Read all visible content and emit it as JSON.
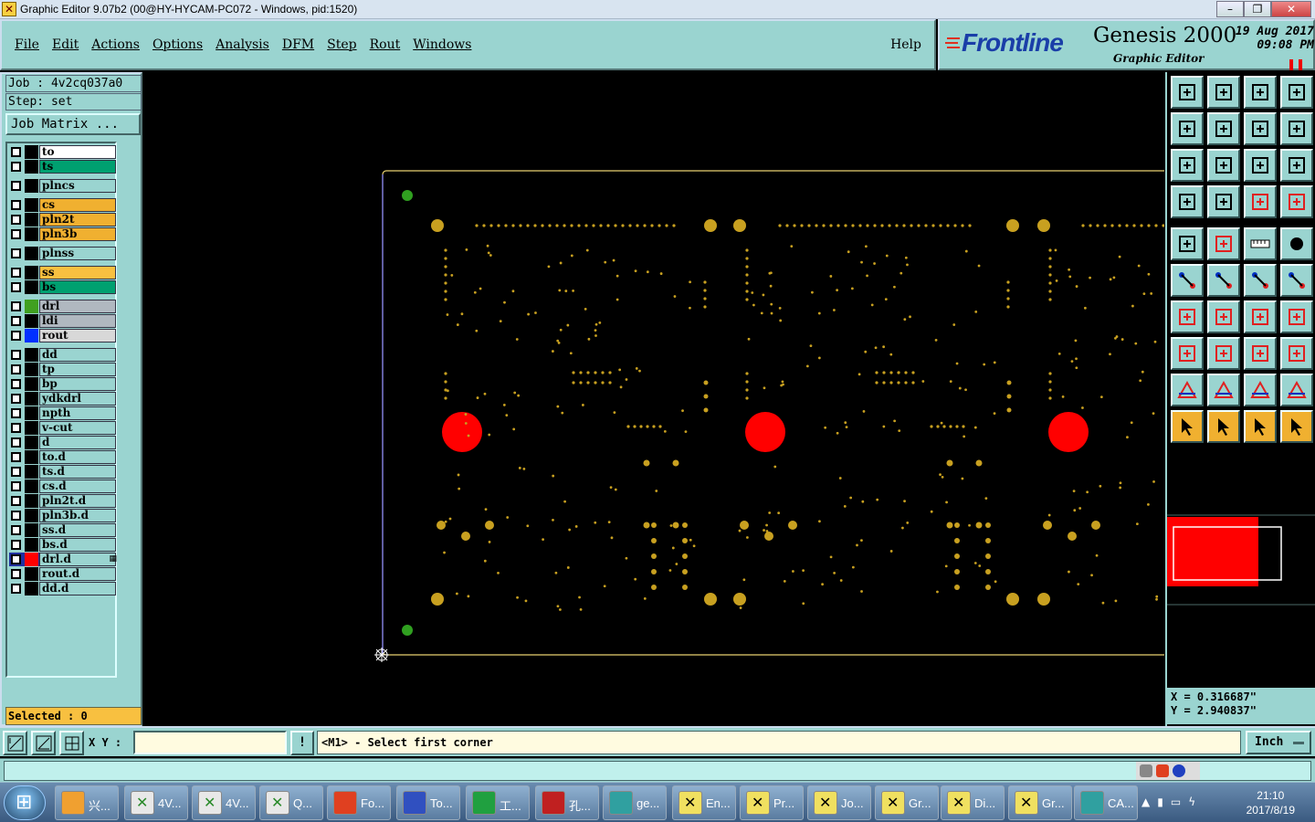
{
  "window": {
    "title": "Graphic Editor 9.07b2 (00@HY-HYCAM-PC072 - Windows, pid:1520)",
    "min": "–",
    "max": "❐",
    "close": "✕"
  },
  "menu": [
    "File",
    "Edit",
    "Actions",
    "Options",
    "Analysis",
    "DFM",
    "Step",
    "Rout",
    "Windows"
  ],
  "help": "Help",
  "brand": {
    "logo": "Frontline",
    "product": "Genesis 2000",
    "subtitle": "Graphic Editor",
    "date": "19 Aug 2017",
    "time": "09:08 PM",
    "pause": "❚❚"
  },
  "job": {
    "job_label": "Job : 4v2cq037a0",
    "step_label": "Step: set",
    "matrix_button": "Job Matrix ..."
  },
  "layers": [
    {
      "name": "to",
      "color": "#ffffff",
      "swatch": "#000000"
    },
    {
      "name": "ts",
      "color": "#00a070",
      "swatch": "#000000"
    },
    {
      "name": "plncs",
      "color": "#9ad4d0",
      "swatch": "#000000",
      "gap": true
    },
    {
      "name": "cs",
      "color": "#f0b030",
      "swatch": "#000000",
      "gap": true
    },
    {
      "name": "pln2t",
      "color": "#f0b030",
      "swatch": "#000000"
    },
    {
      "name": "pln3b",
      "color": "#f0b030",
      "swatch": "#000000"
    },
    {
      "name": "plnss",
      "color": "#9ad4d0",
      "swatch": "#000000",
      "gap": true
    },
    {
      "name": "ss",
      "color": "#f8c040",
      "swatch": "#000000",
      "gap": true
    },
    {
      "name": "bs",
      "color": "#00a070",
      "swatch": "#000000"
    },
    {
      "name": "drl",
      "color": "#b0b8c0",
      "swatch": "#40a020",
      "gap": true
    },
    {
      "name": "ldi",
      "color": "#b0b8c0",
      "swatch": "#000000"
    },
    {
      "name": "rout",
      "color": "#d8d8d8",
      "swatch": "#0030ff"
    },
    {
      "name": "dd",
      "color": "#9ad4d0",
      "swatch": "#000000",
      "gap": true
    },
    {
      "name": "tp",
      "color": "#9ad4d0",
      "swatch": "#000000"
    },
    {
      "name": "bp",
      "color": "#9ad4d0",
      "swatch": "#000000"
    },
    {
      "name": "ydkdrl",
      "color": "#9ad4d0",
      "swatch": "#000000"
    },
    {
      "name": "npth",
      "color": "#9ad4d0",
      "swatch": "#000000"
    },
    {
      "name": "v-cut",
      "color": "#9ad4d0",
      "swatch": "#000000"
    },
    {
      "name": "d",
      "color": "#9ad4d0",
      "swatch": "#000000"
    },
    {
      "name": "to.d",
      "color": "#9ad4d0",
      "swatch": "#000000"
    },
    {
      "name": "ts.d",
      "color": "#9ad4d0",
      "swatch": "#000000"
    },
    {
      "name": "cs.d",
      "color": "#9ad4d0",
      "swatch": "#000000"
    },
    {
      "name": "pln2t.d",
      "color": "#9ad4d0",
      "swatch": "#000000"
    },
    {
      "name": "pln3b.d",
      "color": "#9ad4d0",
      "swatch": "#000000"
    },
    {
      "name": "ss.d",
      "color": "#9ad4d0",
      "swatch": "#000000"
    },
    {
      "name": "bs.d",
      "color": "#9ad4d0",
      "swatch": "#000000"
    },
    {
      "name": "drl.d",
      "color": "#9ad4d0",
      "swatch": "#ff0000",
      "active": true
    },
    {
      "name": "rout.d",
      "color": "#9ad4d0",
      "swatch": "#000000"
    },
    {
      "name": "dd.d",
      "color": "#9ad4d0",
      "swatch": "#000000"
    }
  ],
  "selected": "Selected : 0",
  "coords": {
    "x": "X = 0.316687\"",
    "y": "Y = 2.940837\""
  },
  "status": {
    "xy_label": "X Y :",
    "xy_value": "",
    "prompt": "<M1> - Select first corner",
    "unit": "Inch",
    "bang": "!"
  },
  "taskbar": {
    "tasks": [
      {
        "label": "兴...",
        "icon": "sun"
      },
      {
        "label": "4V...",
        "icon": "xls"
      },
      {
        "label": "4V...",
        "icon": "xls"
      },
      {
        "label": "Q...",
        "icon": "xls"
      },
      {
        "label": "Fo...",
        "icon": "fox"
      },
      {
        "label": "To...",
        "icon": "save"
      },
      {
        "label": "工...",
        "icon": "p"
      },
      {
        "label": "孔...",
        "icon": "pdf"
      },
      {
        "label": "ge...",
        "icon": "eye"
      },
      {
        "label": "En...",
        "icon": "ge"
      },
      {
        "label": "Pr...",
        "icon": "ge"
      },
      {
        "label": "Jo...",
        "icon": "ge"
      },
      {
        "label": "Gr...",
        "icon": "ge"
      },
      {
        "label": "Di...",
        "icon": "ge"
      },
      {
        "label": "Gr...",
        "icon": "ge"
      },
      {
        "label": "CA...",
        "icon": "eye"
      }
    ],
    "time": "21:10",
    "date": "2017/8/19"
  },
  "colors": {
    "panel": "#9ad4d0",
    "accent": "#f0b030",
    "pad": "#c8a020",
    "drill": "#ff0000",
    "outline": "#e8d070"
  }
}
